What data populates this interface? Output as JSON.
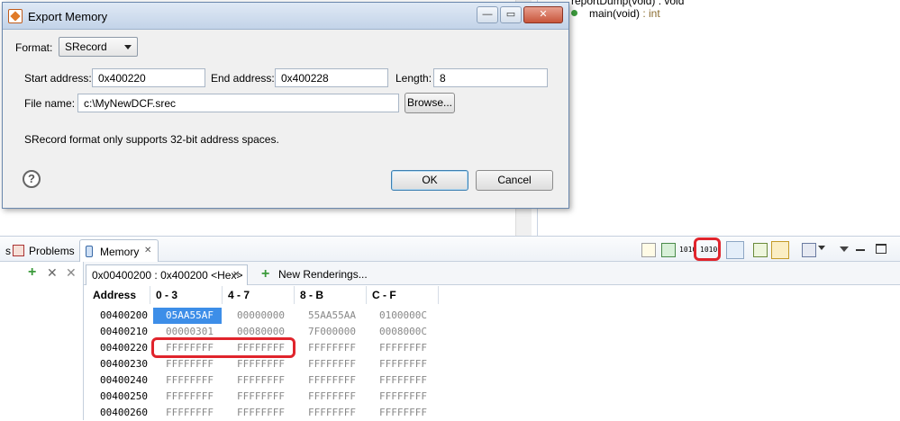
{
  "background_outline": {
    "line1_partial": "reportDump(void) : void",
    "line2_name": "main(void)",
    "line2_type": " : int"
  },
  "dialog": {
    "title": "Export Memory",
    "format_label": "Format:",
    "format_value": "SRecord",
    "start_label": "Start address:",
    "start_value": "0x400220",
    "end_label": "End address:",
    "end_value": "0x400228",
    "length_label": "Length:",
    "length_value": "8",
    "filename_label": "File name:",
    "filename_value": "c:\\MyNewDCF.srec",
    "browse_label": "Browse...",
    "message": "SRecord format only supports 32-bit address spaces.",
    "help_glyph": "?",
    "ok_label": "OK",
    "cancel_label": "Cancel",
    "min_glyph": "—",
    "restore_glyph": "▭",
    "close_glyph": "✕"
  },
  "views": {
    "left_partial": "s",
    "problems_label": "Problems",
    "memory_label": "Memory",
    "memory_close": "✕"
  },
  "renderings": {
    "active_tab": "0x00400200 : 0x400200 <Hex>",
    "active_close": "✕",
    "new_tab": "New Renderings..."
  },
  "memory_table": {
    "headers": [
      "Address",
      "0 - 3",
      "4 - 7",
      "8 - B",
      "C - F"
    ],
    "rows": [
      {
        "addr": "00400200",
        "c0": "05AA55AF",
        "c1": "00000000",
        "c2": "55AA55AA",
        "c3": "0100000C"
      },
      {
        "addr": "00400210",
        "c0": "00000301",
        "c1": "00080000",
        "c2": "7F000000",
        "c3": "0008000C"
      },
      {
        "addr": "00400220",
        "c0": "FFFFFFFF",
        "c1": "FFFFFFFF",
        "c2": "FFFFFFFF",
        "c3": "FFFFFFFF"
      },
      {
        "addr": "00400230",
        "c0": "FFFFFFFF",
        "c1": "FFFFFFFF",
        "c2": "FFFFFFFF",
        "c3": "FFFFFFFF"
      },
      {
        "addr": "00400240",
        "c0": "FFFFFFFF",
        "c1": "FFFFFFFF",
        "c2": "FFFFFFFF",
        "c3": "FFFFFFFF"
      },
      {
        "addr": "00400250",
        "c0": "FFFFFFFF",
        "c1": "FFFFFFFF",
        "c2": "FFFFFFFF",
        "c3": "FFFFFFFF"
      },
      {
        "addr": "00400260",
        "c0": "FFFFFFFF",
        "c1": "FFFFFFFF",
        "c2": "FFFFFFFF",
        "c3": "FFFFFFFF"
      }
    ]
  },
  "toolbar_icons": {
    "import_label": "1010",
    "export_label": "1010"
  },
  "colors": {
    "highlight_red": "#e0242c",
    "selection_blue": "#3d8ee8"
  }
}
